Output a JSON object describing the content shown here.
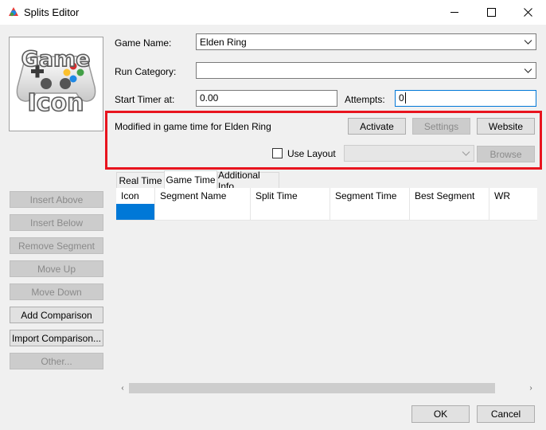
{
  "window": {
    "title": "Splits Editor",
    "icons": {
      "app": "livesplit-logo-icon",
      "minimize": "minimize-icon",
      "maximize": "maximize-icon",
      "close": "close-icon"
    }
  },
  "game_icon": {
    "line1": "Game",
    "line2": "Icon",
    "icon": "game-controller-icon"
  },
  "fields": {
    "game_name_label": "Game Name:",
    "game_name_value": "Elden Ring",
    "run_category_label": "Run Category:",
    "run_category_value": "",
    "start_timer_label": "Start Timer at:",
    "start_timer_value": "0.00",
    "attempts_label": "Attempts:",
    "attempts_value": "0"
  },
  "autosplitter": {
    "description": "Modified in game time for Elden Ring",
    "activate_label": "Activate",
    "settings_label": "Settings",
    "website_label": "Website",
    "use_layout_label": "Use Layout",
    "use_layout_checked": false,
    "layout_value": "",
    "browse_label": "Browse",
    "highlight_color": "#e8141e"
  },
  "sidebar": {
    "insert_above": "Insert Above",
    "insert_below": "Insert Below",
    "remove_segment": "Remove Segment",
    "move_up": "Move Up",
    "move_down": "Move Down",
    "add_comparison": "Add Comparison",
    "import_comparison": "Import Comparison...",
    "other": "Other..."
  },
  "tabs": [
    {
      "label": "Real Time",
      "active": false
    },
    {
      "label": "Game Time",
      "active": true
    },
    {
      "label": "Additional Info",
      "active": false
    }
  ],
  "grid": {
    "columns": [
      "Icon",
      "Segment Name",
      "Split Time",
      "Segment Time",
      "Best Segment",
      "WR"
    ],
    "rows": [
      [
        "",
        "",
        "",
        "",
        "",
        ""
      ]
    ],
    "selection_color": "#0078d7"
  },
  "footer": {
    "ok_label": "OK",
    "cancel_label": "Cancel"
  },
  "scrollbar": {
    "left_arrow": "‹",
    "right_arrow": "›"
  }
}
